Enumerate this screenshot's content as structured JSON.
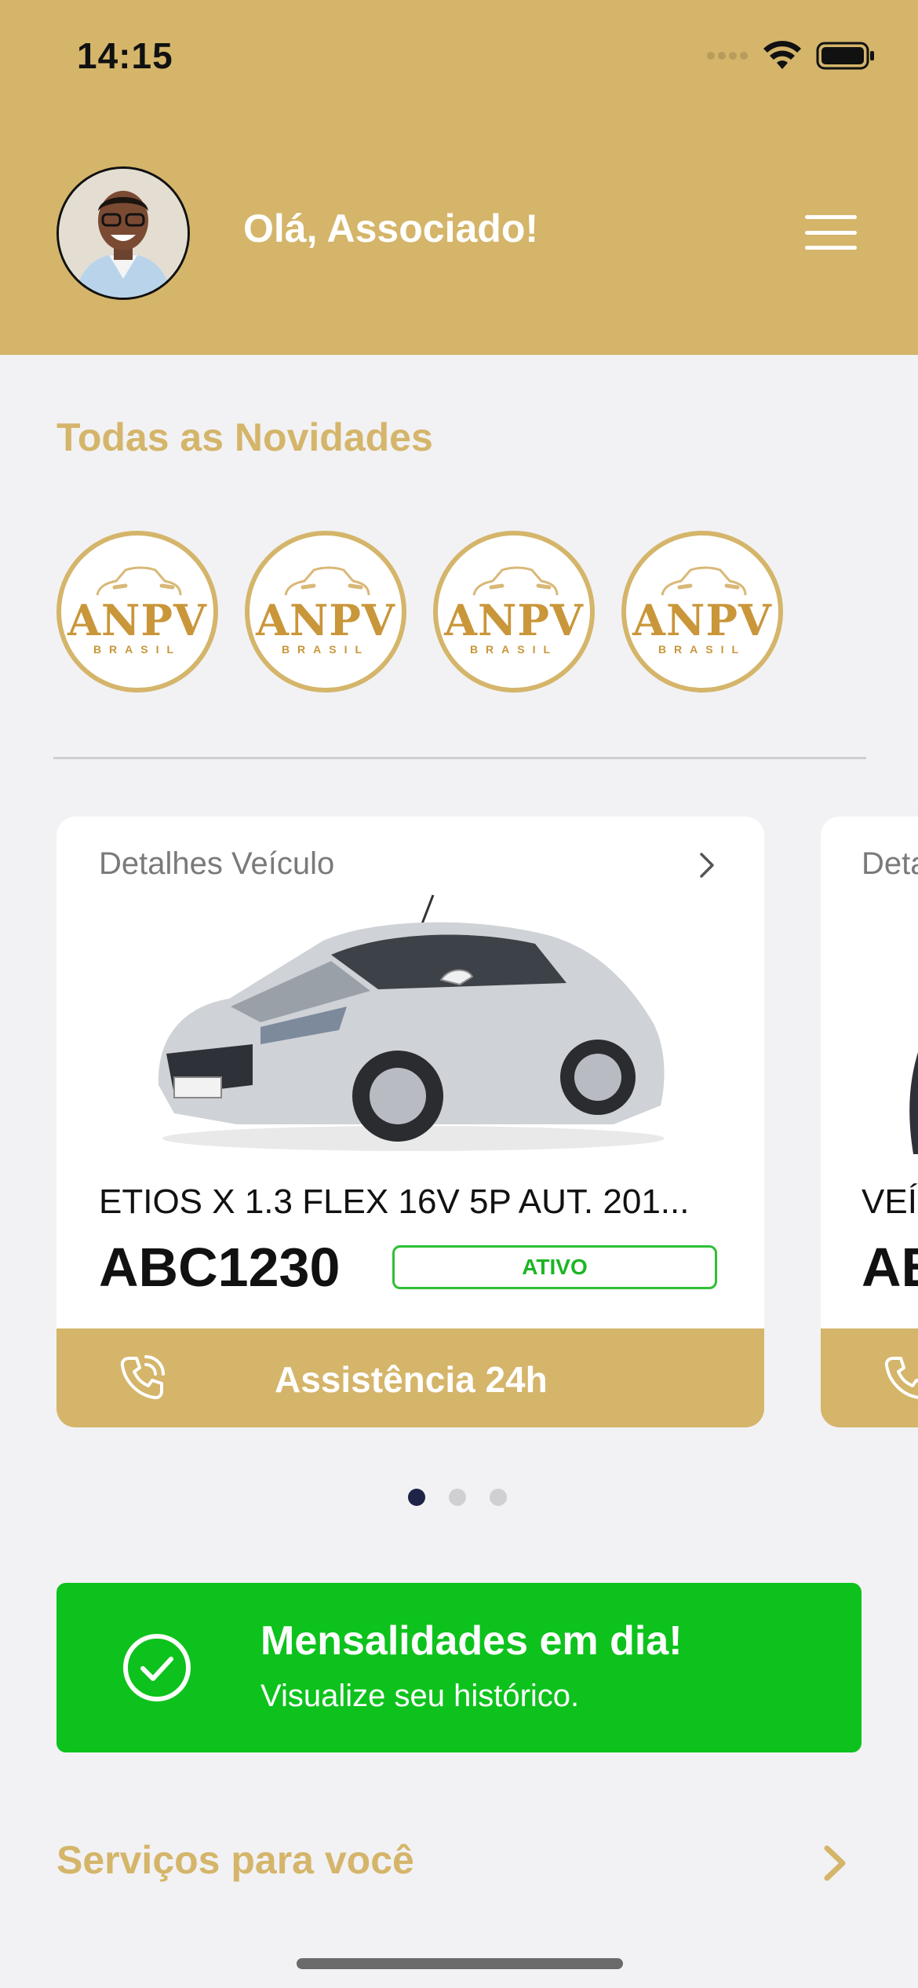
{
  "status_bar": {
    "time": "14:15"
  },
  "header": {
    "greeting": "Olá, Associado!"
  },
  "news": {
    "title": "Todas as Novidades",
    "stories": [
      {
        "logo": "ANPV",
        "sub": "BRASIL"
      },
      {
        "logo": "ANPV",
        "sub": "BRASIL"
      },
      {
        "logo": "ANPV",
        "sub": "BRASIL"
      },
      {
        "logo": "ANPV",
        "sub": "BRASIL"
      }
    ]
  },
  "vehicles": [
    {
      "title": "Detalhes Veículo",
      "model": "ETIOS X 1.3 FLEX 16V 5P AUT. 201...",
      "plate": "ABC1230",
      "status": "ATIVO",
      "assist_label": "Assistência 24h"
    },
    {
      "title": "Deta",
      "model": "VEÍ",
      "plate": "AB"
    }
  ],
  "carousel": {
    "pages": 3,
    "active_index": 0
  },
  "payments": {
    "title": "Mensalidades em dia!",
    "subtitle": "Visualize seu histórico."
  },
  "services": {
    "title": "Serviços para você"
  },
  "colors": {
    "brand_gold": "#d4b56a",
    "success_green": "#0dc21c",
    "active_dot": "#1e2348"
  }
}
